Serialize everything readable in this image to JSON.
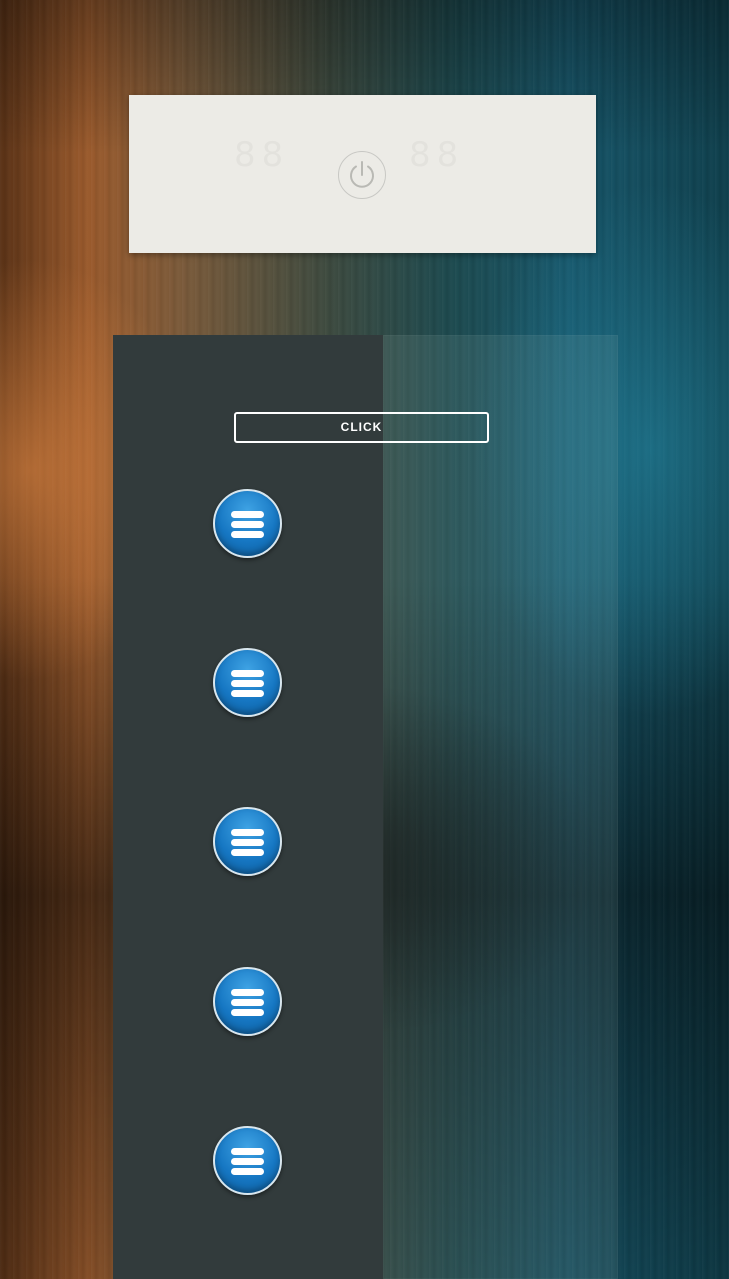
{
  "background": {
    "colors": [
      "#9a5a2c",
      "#3d4a3f",
      "#17566a"
    ]
  },
  "top_panel": {
    "background_color": "#ecebe6",
    "power_icon": "power-icon"
  },
  "side_panel": {
    "left_color": "#323b3c",
    "click_button_label": "CLICK",
    "menu_buttons": [
      {
        "icon": "menu-icon",
        "color": "#1677c3"
      },
      {
        "icon": "menu-icon",
        "color": "#1677c3"
      },
      {
        "icon": "menu-icon",
        "color": "#1677c3"
      },
      {
        "icon": "menu-icon",
        "color": "#1677c3"
      },
      {
        "icon": "menu-icon",
        "color": "#1677c3"
      }
    ]
  }
}
